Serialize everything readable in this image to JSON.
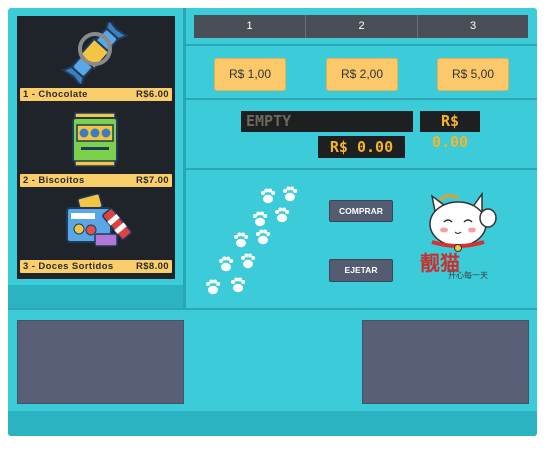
{
  "products": [
    {
      "label": "1 - Chocolate",
      "price": "R$6.00",
      "icon": "chocolate-bar-icon"
    },
    {
      "label": "2 - Biscoitos",
      "price": "R$7.00",
      "icon": "cookie-pack-icon"
    },
    {
      "label": "3 - Doces Sortidos",
      "price": "R$8.00",
      "icon": "assorted-sweets-icon"
    }
  ],
  "tabs": [
    "1",
    "2",
    "3"
  ],
  "coins": [
    "R$ 1,00",
    "R$ 2,00",
    "R$ 5,00"
  ],
  "displays": {
    "status": "EMPTY",
    "credit": "R$ 0.00",
    "change": "R$ 0.00"
  },
  "actions": {
    "buy": "COMPRAR",
    "eject": "EJETAR"
  },
  "mascot": {
    "chinese_title": "靓猫",
    "caption": "开心每一天",
    "icon": "lucky-cat-icon"
  },
  "colors": {
    "machine": "#3ccbd9",
    "shelf": "#1f242b",
    "label": "#f9ce6b",
    "button": "#545c72",
    "lcd_text": "#f5b42b"
  }
}
